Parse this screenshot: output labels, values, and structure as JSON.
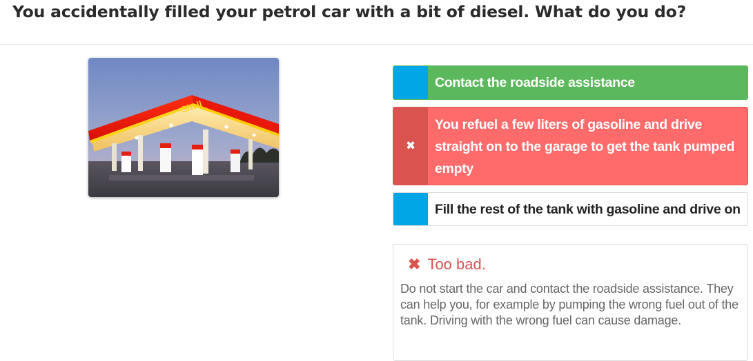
{
  "question": "You accidentally filled your petrol car with a bit of diesel. What do you do?",
  "image": {
    "brand_text": "Shell",
    "alt": "Petrol station"
  },
  "answers": [
    {
      "label": "Contact the roadside assistance",
      "state": "correct",
      "marker": ""
    },
    {
      "label": "You refuel a few liters of gasoline and drive straight on to the garage to get the tank pumped empty",
      "state": "wrong",
      "marker": "✖"
    },
    {
      "label": "Fill the rest of the tank with gasoline and drive on",
      "state": "neutral",
      "marker": ""
    }
  ],
  "feedback": {
    "icon": "✖",
    "title": "Too bad.",
    "body": "Do not start the car and contact the roadside assistance. They can help you, for example by pumping the wrong fuel out of the tank. Driving with the wrong fuel can cause damage."
  },
  "colors": {
    "accent_blue": "#00a6e6",
    "correct_green": "#5cb85c",
    "wrong_red": "#ff6b6b",
    "wrong_marker": "#d9534f"
  }
}
